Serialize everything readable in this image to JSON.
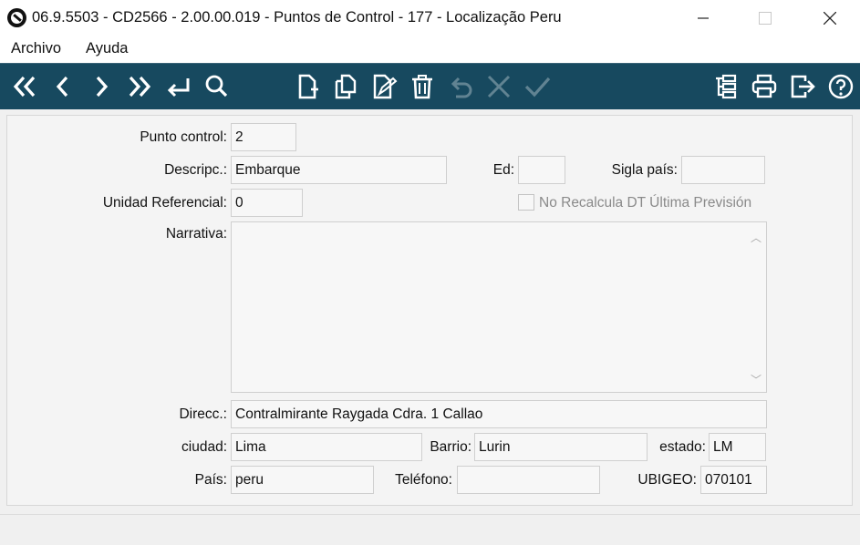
{
  "window": {
    "title": "06.9.5503 - CD2566 - 2.00.00.019 - Puntos de Control - 177 - Localização Peru",
    "minimize": "—",
    "maximize": "☐",
    "close": "✕"
  },
  "menu": {
    "items": [
      "Archivo",
      "Ayuda"
    ]
  },
  "toolbar": {
    "icons": [
      "first-record-icon",
      "previous-record-icon",
      "next-record-icon",
      "last-record-icon",
      "enter-icon",
      "search-icon",
      "new-document-icon",
      "copy-document-icon",
      "edit-document-icon",
      "trash-icon",
      "undo-icon",
      "cancel-icon",
      "confirm-icon",
      "structure-icon",
      "print-icon",
      "exit-icon",
      "help-icon"
    ],
    "icon_color": "#ffffff",
    "background": "#17495f"
  },
  "form": {
    "punto_control": {
      "label": "Punto control:",
      "value": "2"
    },
    "descripcion": {
      "label": "Descripc.:",
      "value": "Embarque"
    },
    "ed": {
      "label": "Ed:",
      "value": ""
    },
    "sigla_pais": {
      "label": "Sigla país:",
      "value": ""
    },
    "unidad_referencial": {
      "label": "Unidad Referencial:",
      "value": "0"
    },
    "no_recalcula": {
      "label": "No Recalcula DT Última Previsión",
      "checked": false
    },
    "narrativa": {
      "label": "Narrativa:",
      "value": ""
    },
    "direccion": {
      "label": "Direcc.:",
      "value": "Contralmirante Raygada Cdra. 1 Callao"
    },
    "ciudad": {
      "label": "ciudad:",
      "value": "Lima"
    },
    "barrio": {
      "label": "Barrio:",
      "value": "Lurin"
    },
    "estado": {
      "label": "estado:",
      "value": "LM"
    },
    "pais": {
      "label": "País:",
      "value": "peru"
    },
    "telefono": {
      "label": "Teléfono:",
      "value": ""
    },
    "ubigeo": {
      "label": "UBIGEO:",
      "value": "070101"
    }
  },
  "scroll": {
    "up": "︿",
    "down": "﹀"
  }
}
